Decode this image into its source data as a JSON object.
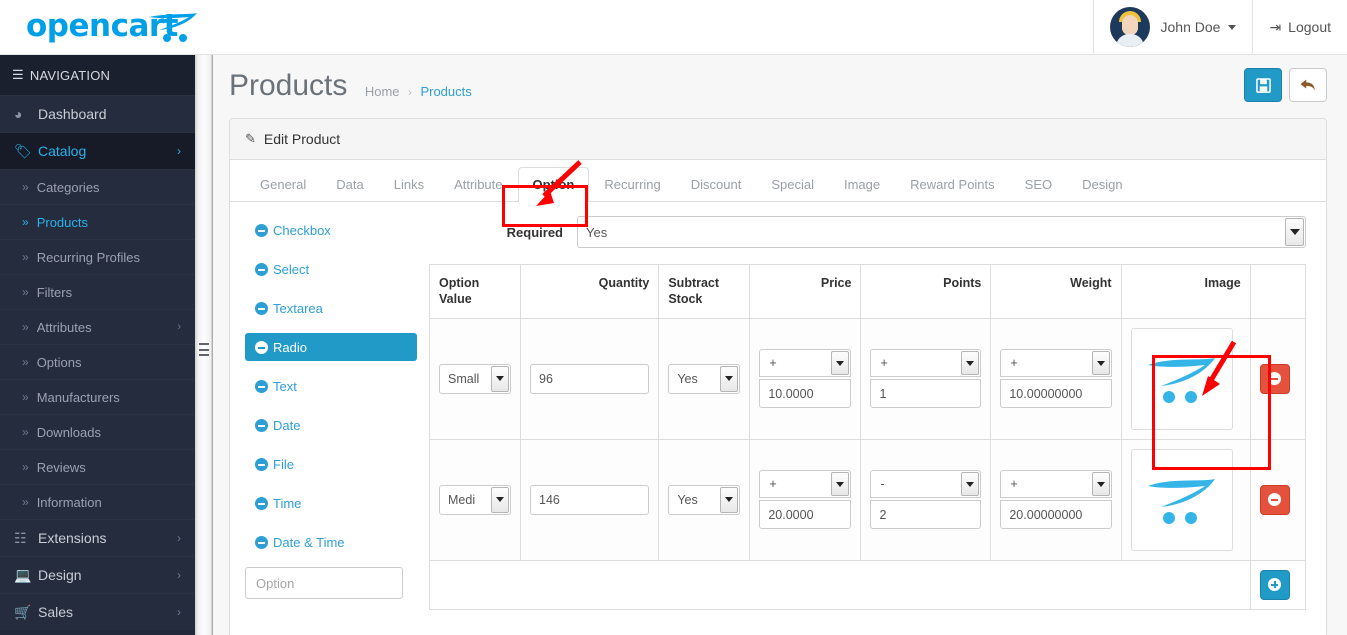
{
  "brand": {
    "name": "opencart",
    "cart_icon": "shopping-cart-icon"
  },
  "topbar": {
    "user_name": "John Doe",
    "logout_label": "Logout",
    "logout_icon": "logout-icon",
    "avatar_icon": "avatar"
  },
  "sidebar": {
    "header": "NAVIGATION",
    "items": [
      {
        "label": "Dashboard",
        "icon": "dashboard-icon",
        "level": 1,
        "active": false,
        "chevron": false
      },
      {
        "label": "Catalog",
        "icon": "tag-icon",
        "level": 1,
        "active": true,
        "chevron": true
      },
      {
        "label": "Categories",
        "icon": "angle-double-right-icon",
        "level": 2,
        "active": false,
        "chevron": false
      },
      {
        "label": "Products",
        "icon": "angle-double-right-icon",
        "level": 2,
        "active": true,
        "chevron": false
      },
      {
        "label": "Recurring Profiles",
        "icon": "angle-double-right-icon",
        "level": 2,
        "active": false,
        "chevron": false
      },
      {
        "label": "Filters",
        "icon": "angle-double-right-icon",
        "level": 2,
        "active": false,
        "chevron": false
      },
      {
        "label": "Attributes",
        "icon": "angle-double-right-icon",
        "level": 2,
        "active": false,
        "chevron": true
      },
      {
        "label": "Options",
        "icon": "angle-double-right-icon",
        "level": 2,
        "active": false,
        "chevron": false
      },
      {
        "label": "Manufacturers",
        "icon": "angle-double-right-icon",
        "level": 2,
        "active": false,
        "chevron": false
      },
      {
        "label": "Downloads",
        "icon": "angle-double-right-icon",
        "level": 2,
        "active": false,
        "chevron": false
      },
      {
        "label": "Reviews",
        "icon": "angle-double-right-icon",
        "level": 2,
        "active": false,
        "chevron": false
      },
      {
        "label": "Information",
        "icon": "angle-double-right-icon",
        "level": 2,
        "active": false,
        "chevron": false
      },
      {
        "label": "Extensions",
        "icon": "puzzle-icon",
        "level": 1,
        "active": false,
        "chevron": true
      },
      {
        "label": "Design",
        "icon": "monitor-icon",
        "level": 1,
        "active": false,
        "chevron": true
      },
      {
        "label": "Sales",
        "icon": "cart-icon",
        "level": 1,
        "active": false,
        "chevron": true
      }
    ]
  },
  "page": {
    "title": "Products",
    "breadcrumb": [
      {
        "label": "Home",
        "current": false
      },
      {
        "label": "Products",
        "current": true
      }
    ],
    "save_icon": "floppy-save-icon",
    "back_icon": "reply-back-icon"
  },
  "panel": {
    "heading": "Edit Product",
    "heading_icon": "pencil-icon"
  },
  "tabs": [
    {
      "label": "General",
      "active": false
    },
    {
      "label": "Data",
      "active": false
    },
    {
      "label": "Links",
      "active": false
    },
    {
      "label": "Attribute",
      "active": false
    },
    {
      "label": "Option",
      "active": true
    },
    {
      "label": "Recurring",
      "active": false
    },
    {
      "label": "Discount",
      "active": false
    },
    {
      "label": "Special",
      "active": false
    },
    {
      "label": "Image",
      "active": false
    },
    {
      "label": "Reward Points",
      "active": false
    },
    {
      "label": "SEO",
      "active": false
    },
    {
      "label": "Design",
      "active": false
    }
  ],
  "option_list": {
    "items": [
      {
        "label": "Checkbox",
        "active": false
      },
      {
        "label": "Select",
        "active": false
      },
      {
        "label": "Textarea",
        "active": false
      },
      {
        "label": "Radio",
        "active": true
      },
      {
        "label": "Text",
        "active": false
      },
      {
        "label": "Date",
        "active": false
      },
      {
        "label": "File",
        "active": false
      },
      {
        "label": "Time",
        "active": false
      },
      {
        "label": "Date & Time",
        "active": false
      }
    ],
    "search_placeholder": "Option",
    "search_value": ""
  },
  "required_field": {
    "label": "Required",
    "value": "Yes"
  },
  "table": {
    "headers": [
      {
        "label": "Option Value",
        "align": "left"
      },
      {
        "label": "Quantity",
        "align": "right"
      },
      {
        "label": "Subtract Stock",
        "align": "left"
      },
      {
        "label": "Price",
        "align": "right"
      },
      {
        "label": "Points",
        "align": "right"
      },
      {
        "label": "Weight",
        "align": "right"
      },
      {
        "label": "Image",
        "align": "right"
      },
      {
        "label": "",
        "align": "center"
      }
    ],
    "rows": [
      {
        "option_value": "Small",
        "quantity": "96",
        "subtract_stock": "Yes",
        "price_prefix": "+",
        "price": "10.0000",
        "points_prefix": "+",
        "points": "1",
        "weight_prefix": "+",
        "weight": "10.00000000",
        "image_icon": "opencart-cart-logo",
        "remove_icon": "minus-circle-icon"
      },
      {
        "option_value": "Medi",
        "quantity": "146",
        "subtract_stock": "Yes",
        "price_prefix": "+",
        "price": "20.0000",
        "points_prefix": "-",
        "points": "2",
        "weight_prefix": "+",
        "weight": "20.00000000",
        "image_icon": "opencart-cart-logo",
        "remove_icon": "minus-circle-icon"
      }
    ],
    "add_row_icon": "plus-circle-icon"
  },
  "annotations": [
    {
      "name": "option-tab-highlight",
      "type": "box"
    },
    {
      "name": "option-tab-arrow",
      "type": "arrow"
    },
    {
      "name": "image-cell-highlight",
      "type": "box"
    },
    {
      "name": "image-cell-arrow",
      "type": "arrow"
    }
  ],
  "colors": {
    "accent": "#229ac8",
    "sidebar": "#22293a",
    "danger": "#e4513d",
    "annotation": "#fe0000",
    "brand": "#00a0e9"
  }
}
